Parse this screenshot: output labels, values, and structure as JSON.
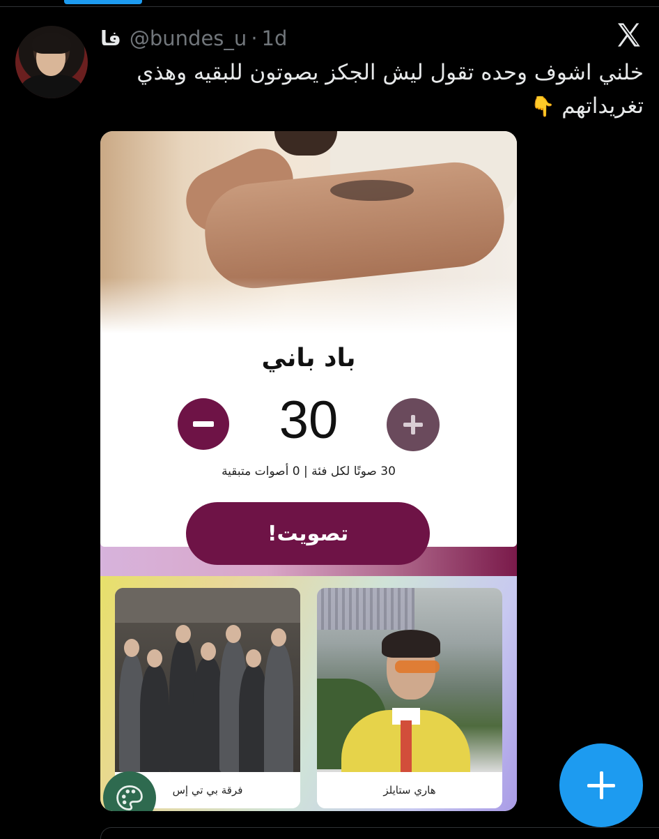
{
  "tweet": {
    "display_name": "فا",
    "handle": "@bundes_u",
    "separator": "·",
    "time": "1d",
    "text": "خلني اشوف وحده تقول ليش الجكز يصوتون للبقيه وهذي تغريداتهم",
    "emoji": "👇",
    "logo_icon": "x-logo-icon"
  },
  "card": {
    "artist_name": "باد باني",
    "vote_count": "30",
    "vote_info": "30 صوتًا لكل فئة | 0 أصوات متبقية",
    "vote_button": "تصويت!",
    "accent_color": "#6e1346",
    "nominees": [
      {
        "label": "فرقة بي تي إس"
      },
      {
        "label": "هاري ستايلز"
      }
    ]
  },
  "colors": {
    "background": "#000000",
    "fab": "#1d9bf0",
    "palette_button": "#2e6a4f"
  }
}
